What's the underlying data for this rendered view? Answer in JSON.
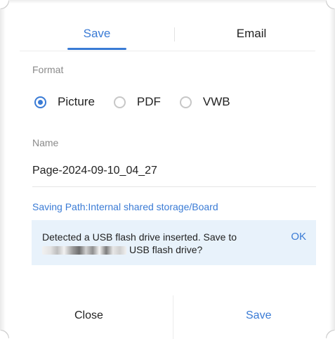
{
  "tabs": {
    "save_label": "Save",
    "email_label": "Email",
    "active": "save"
  },
  "format": {
    "label": "Format",
    "options": [
      {
        "label": "Picture",
        "checked": true
      },
      {
        "label": "PDF",
        "checked": false
      },
      {
        "label": "VWB",
        "checked": false
      }
    ]
  },
  "name": {
    "label": "Name",
    "value": "Page-2024-09-10_04_27"
  },
  "saving_path": "Saving Path:Internal shared storage/Board",
  "notice": {
    "line1": "Detected a USB flash drive inserted. Save to",
    "line2": "USB flash drive?",
    "ok_label": "OK"
  },
  "footer": {
    "close_label": "Close",
    "save_label": "Save"
  },
  "colors": {
    "accent": "#3a7bd5",
    "notice_bg": "#e8f2fb"
  }
}
